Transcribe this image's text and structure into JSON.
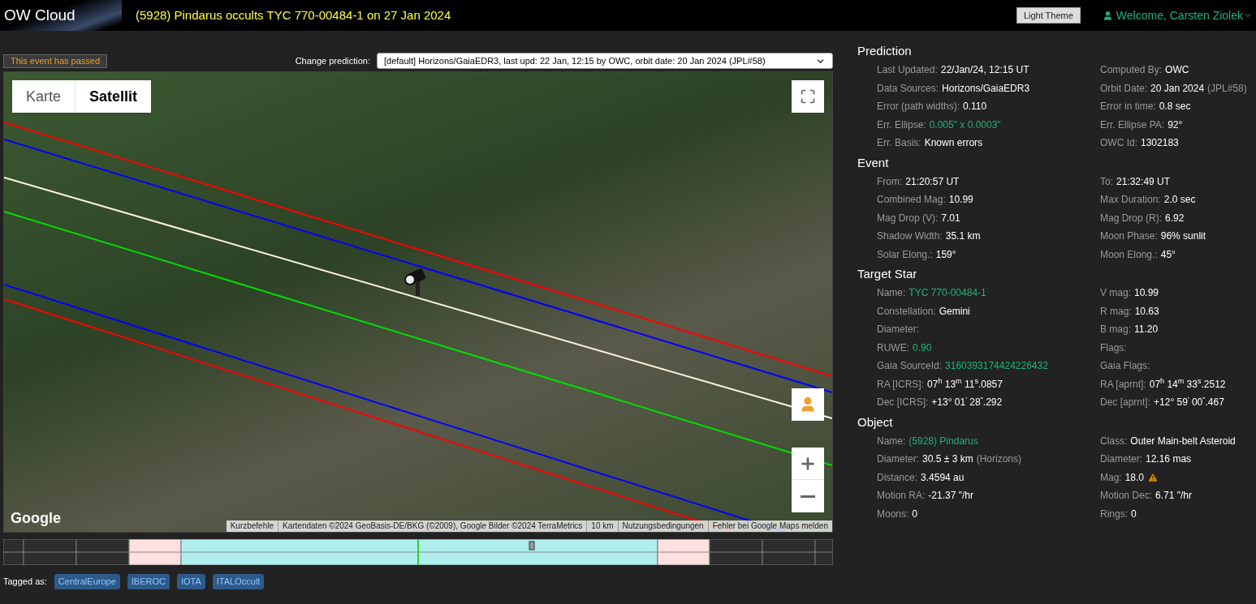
{
  "header": {
    "brand": "OW Cloud",
    "title": "(5928) Pindarus occults TYC 770-00484-1 on 27 Jan 2024",
    "theme_button": "Light Theme",
    "welcome": "Welcome, Carsten Ziolek"
  },
  "status_badge": "This event has passed",
  "prediction_select": {
    "label": "Change prediction:",
    "value": "[default] Horizons/GaiaEDR3, last upd: 22 Jan, 12:15 by OWC, orbit date: 20 Jan 2024 (JPL#58)"
  },
  "map": {
    "types": [
      {
        "label": "Karte",
        "selected": false
      },
      {
        "label": "Satellit",
        "selected": true
      }
    ],
    "logo": "Google",
    "attribution": [
      "Kurzbefehle",
      "Kartendaten ©2024 GeoBasis-DE/BKG (©2009), Google Bilder ©2024 TerraMetrics",
      "10 km",
      "Nutzungsbedingungen",
      "Fehler bei Google Maps melden"
    ],
    "paths": [
      {
        "color": "#ff0000"
      },
      {
        "color": "#0000ff"
      },
      {
        "color": "#fff5e0"
      },
      {
        "color": "#00dd00"
      },
      {
        "color": "#0000ff"
      },
      {
        "color": "#ff0000"
      }
    ]
  },
  "tags": {
    "label": "Tagged as:",
    "items": [
      "CentralEurope",
      "IBEROC",
      "IOTA",
      "ITALOccult"
    ]
  },
  "sections": [
    {
      "title": "Prediction",
      "fields": [
        {
          "label": "Last Updated:",
          "value": "22/Jan/24, 12:15 UT",
          "kind": "text"
        },
        {
          "label": "Computed By:",
          "value": "OWC",
          "kind": "text"
        },
        {
          "label": "Data Sources:",
          "value": "Horizons/GaiaEDR3",
          "kind": "text"
        },
        {
          "label": "Orbit Date:",
          "value": "20 Jan 2024",
          "note": "(JPL#58)",
          "kind": "text"
        },
        {
          "label": "Error (path widths):",
          "value": "0.110",
          "kind": "text"
        },
        {
          "label": "Error in time:",
          "value": "0.8 sec",
          "kind": "text"
        },
        {
          "label": "Err. Ellipse:",
          "value": "0.005\" x 0.0003\"",
          "kind": "link"
        },
        {
          "label": "Err. Ellipse PA:",
          "value": "92°",
          "kind": "text"
        },
        {
          "label": "Err. Basis:",
          "value": "Known errors",
          "kind": "text"
        },
        {
          "label": "OWC Id:",
          "value": "1302183",
          "kind": "text"
        }
      ]
    },
    {
      "title": "Event",
      "fields": [
        {
          "label": "From:",
          "value": "21:20:57 UT",
          "kind": "text"
        },
        {
          "label": "To:",
          "value": "21:32:49 UT",
          "kind": "text"
        },
        {
          "label": "Combined Mag:",
          "value": "10.99",
          "kind": "text"
        },
        {
          "label": "Max Duration:",
          "value": "2.0 sec",
          "kind": "text"
        },
        {
          "label": "Mag Drop (V):",
          "value": "7.01",
          "kind": "text"
        },
        {
          "label": "Mag Drop (R):",
          "value": "6.92",
          "kind": "text"
        },
        {
          "label": "Shadow Width:",
          "value": "35.1 km",
          "kind": "text"
        },
        {
          "label": "Moon Phase:",
          "value": "96% sunlit",
          "kind": "text"
        },
        {
          "label": "Solar Elong.:",
          "value": "159°",
          "kind": "text"
        },
        {
          "label": "Moon Elong.:",
          "value": "45°",
          "kind": "text"
        }
      ]
    },
    {
      "title": "Target Star",
      "fields": [
        {
          "label": "Name:",
          "value": "TYC 770-00484-1",
          "kind": "link"
        },
        {
          "label": "V mag:",
          "value": "10.99",
          "kind": "text"
        },
        {
          "label": "Constellation:",
          "value": "Gemini",
          "kind": "text"
        },
        {
          "label": "R mag:",
          "value": "10.63",
          "kind": "text"
        },
        {
          "label": "Diameter:",
          "kind": "text"
        },
        {
          "label": "B mag:",
          "value": "11.20",
          "kind": "text"
        },
        {
          "label": "RUWE:",
          "value": "0.90",
          "kind": "link"
        },
        {
          "label": "Flags:",
          "kind": "text"
        },
        {
          "label": "Gaia SourceId:",
          "value": "3160393174424226432",
          "kind": "link"
        },
        {
          "label": "Gaia Flags:",
          "kind": "text"
        },
        {
          "label": "RA [ICRS]:",
          "value": "07$^{h}$ 13$^{m}$ 11$^{s}$.0857",
          "kind": "text"
        },
        {
          "label": "RA [aprnt]:",
          "value": "07$^{h}$ 14$^{m}$ 33$^{s}$.2512",
          "kind": "text"
        },
        {
          "label": "Dec [ICRS]:",
          "value": "+13° 01$^{'}$ 28$^{\"}$.292",
          "kind": "text"
        },
        {
          "label": "Dec [aprnt]:",
          "value": "+12° 59$^{'}$ 00$^{\"}$.467",
          "kind": "text"
        }
      ]
    },
    {
      "title": "Object",
      "fields": [
        {
          "label": "Name:",
          "value": "(5928) Pindarus",
          "kind": "link"
        },
        {
          "label": "Class:",
          "value": "Outer Main-belt Asteroid",
          "kind": "text"
        },
        {
          "label": "Diameter:",
          "value": "30.5 ± 3 km",
          "note": "(Horizons)",
          "kind": "text"
        },
        {
          "label": "Diameter:",
          "value": "12.16 mas",
          "kind": "text"
        },
        {
          "label": "Distance:",
          "value": "3.4594 au",
          "kind": "text"
        },
        {
          "label": "Mag:",
          "value": "18.0",
          "warning": true,
          "kind": "text"
        },
        {
          "label": "Motion RA:",
          "value": "-21.37 \"/hr",
          "kind": "text"
        },
        {
          "label": "Motion Dec:",
          "value": "6.71 \"/hr",
          "kind": "text"
        },
        {
          "label": "Moons:",
          "value": "0",
          "kind": "text"
        },
        {
          "label": "Rings:",
          "value": "0",
          "kind": "text"
        }
      ]
    }
  ]
}
